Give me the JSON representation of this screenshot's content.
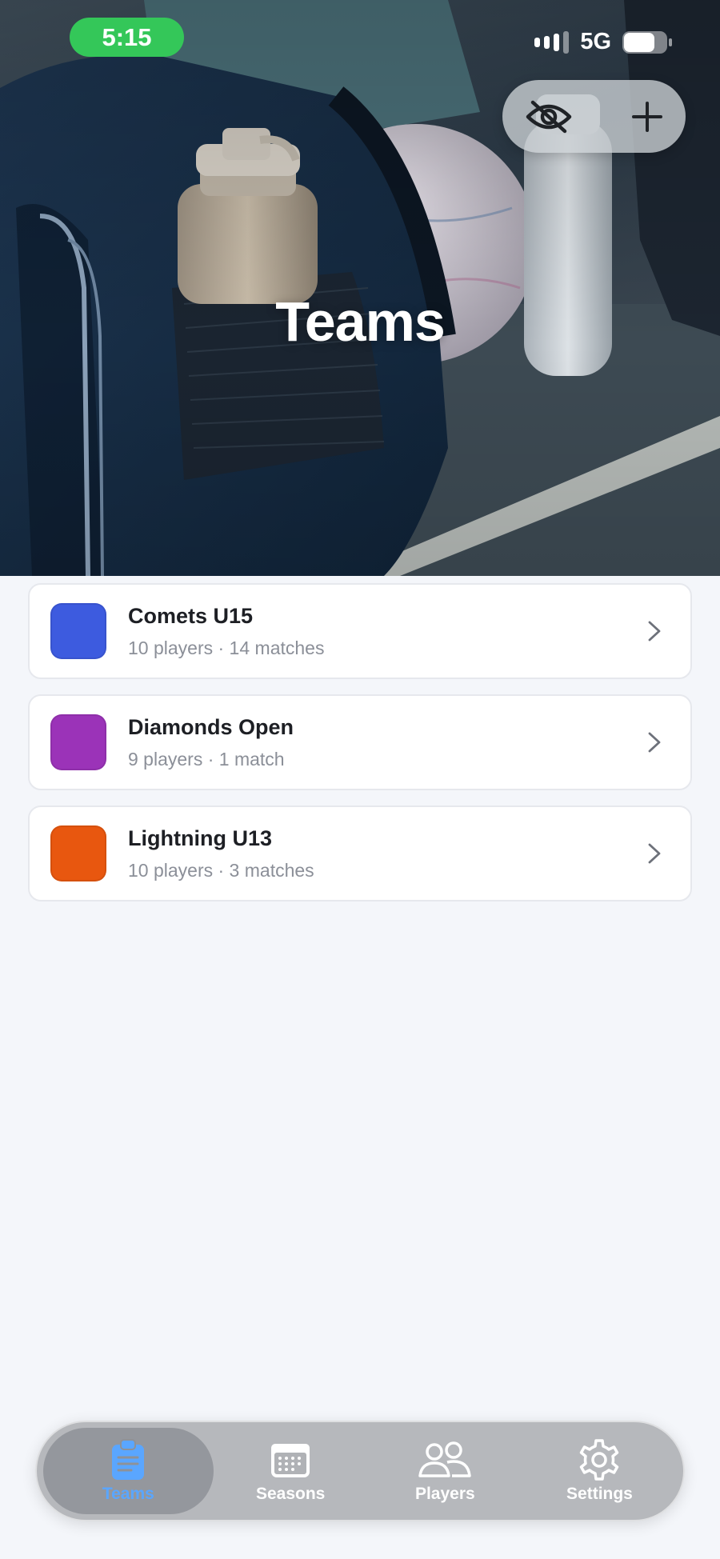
{
  "status_bar": {
    "time": "5:15",
    "network": "5G"
  },
  "header": {
    "title": "Teams",
    "hide_icon": "eye-slash-icon",
    "add_icon": "plus-icon"
  },
  "teams": [
    {
      "name": "Comets U15",
      "meta": "10 players · 14 matches",
      "color": "#3d5bdf"
    },
    {
      "name": "Diamonds Open",
      "meta": "9 players · 1 match",
      "color": "#9b33b8"
    },
    {
      "name": "Lightning U13",
      "meta": "10 players · 3 matches",
      "color": "#e8570f"
    }
  ],
  "tab_bar": {
    "active_color": "#5aa6ff",
    "tabs": [
      {
        "label": "Teams",
        "icon": "clipboard-icon",
        "active": true
      },
      {
        "label": "Seasons",
        "icon": "calendar-icon",
        "active": false
      },
      {
        "label": "Players",
        "icon": "people-icon",
        "active": false
      },
      {
        "label": "Settings",
        "icon": "gear-icon",
        "active": false
      }
    ]
  }
}
